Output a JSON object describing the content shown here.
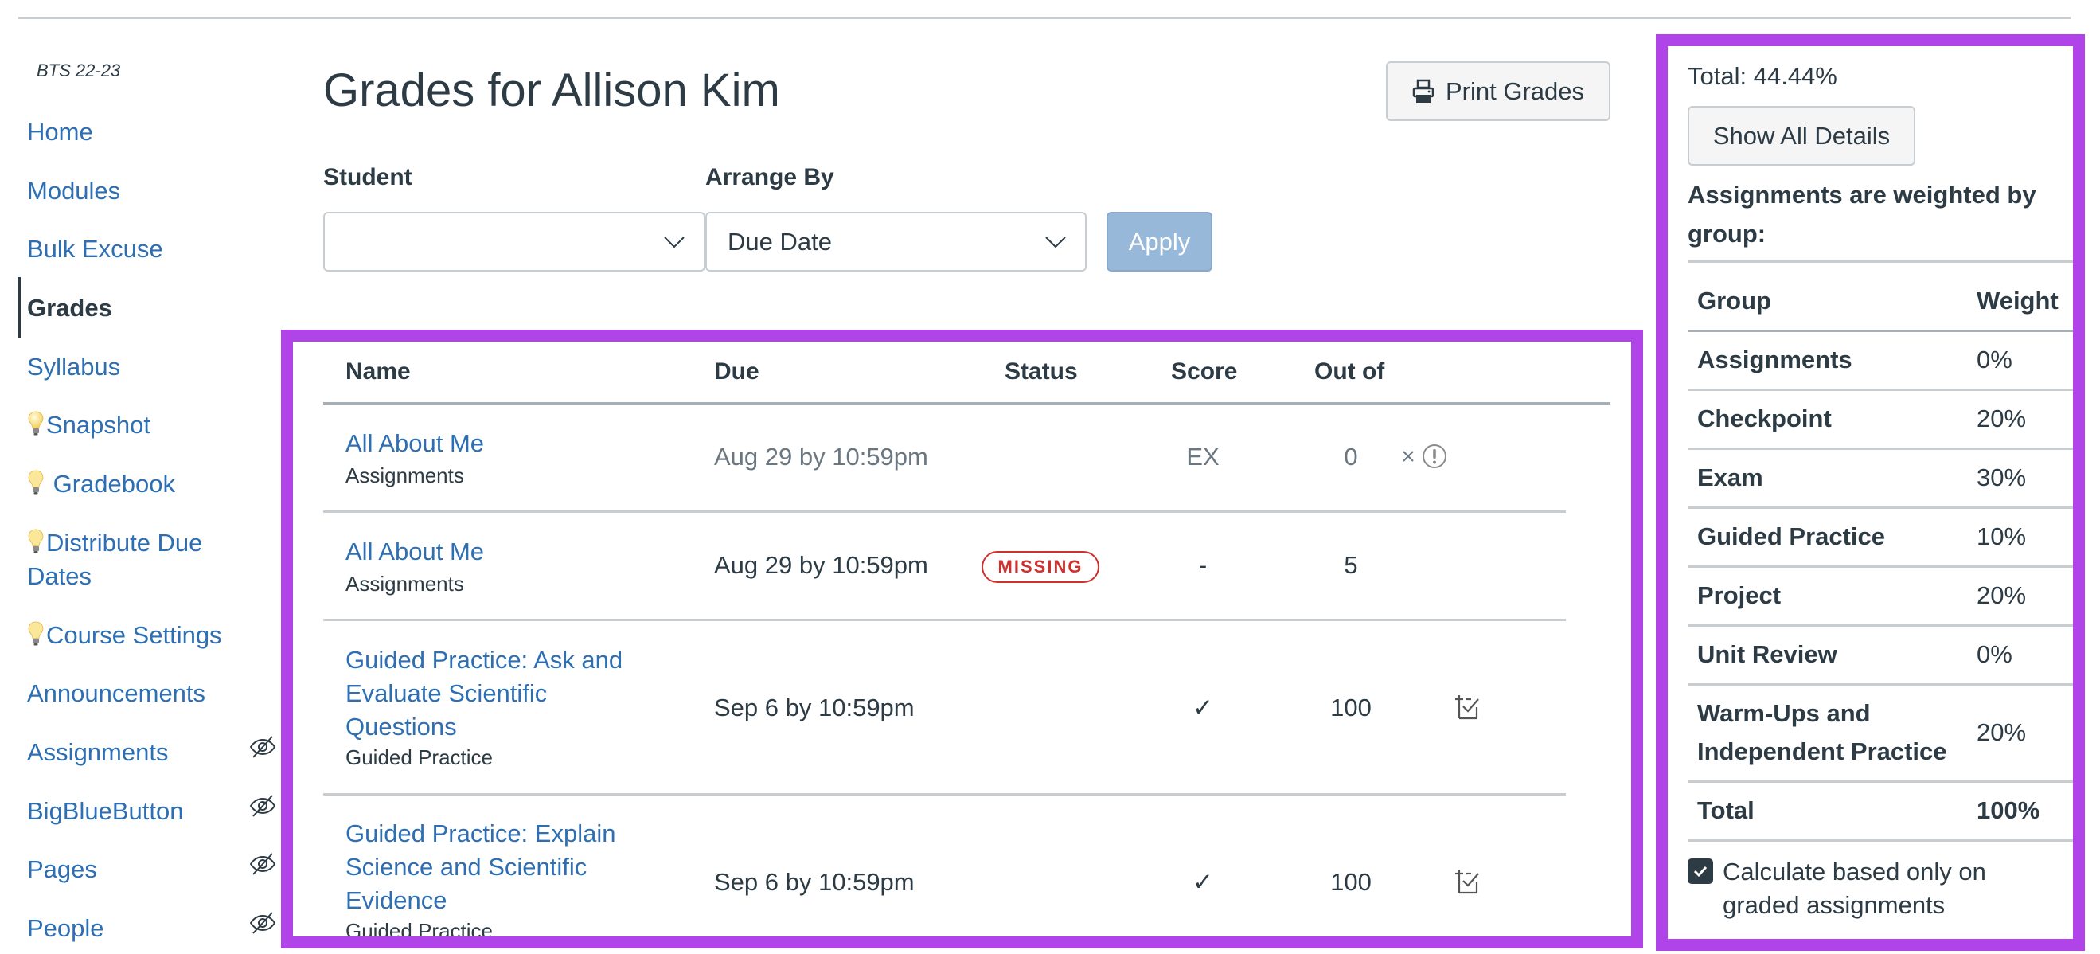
{
  "course": {
    "label": "BTS 22-23"
  },
  "sidebar": {
    "items": [
      {
        "label": "Home",
        "icon": null,
        "hidden": false,
        "active": false
      },
      {
        "label": "Modules",
        "icon": null,
        "hidden": false,
        "active": false
      },
      {
        "label": "Bulk Excuse",
        "icon": null,
        "hidden": false,
        "active": false
      },
      {
        "label": "Grades",
        "icon": null,
        "hidden": false,
        "active": true
      },
      {
        "label": "Syllabus",
        "icon": null,
        "hidden": false,
        "active": false
      },
      {
        "label": "Snapshot",
        "icon": "lightbulb-icon",
        "hidden": false,
        "active": false
      },
      {
        "label": " Gradebook",
        "icon": "lightbulb-icon",
        "hidden": false,
        "active": false
      },
      {
        "label": "Distribute Due",
        "label_line2": "Dates",
        "icon": "lightbulb-icon",
        "hidden": false,
        "active": false
      },
      {
        "label": "Course Settings",
        "icon": "lightbulb-icon",
        "hidden": false,
        "active": false
      },
      {
        "label": "Announcements",
        "icon": null,
        "hidden": false,
        "active": false
      },
      {
        "label": "Assignments",
        "icon": null,
        "hidden": true,
        "active": false
      },
      {
        "label": "BigBlueButton",
        "icon": null,
        "hidden": true,
        "active": false
      },
      {
        "label": "Pages",
        "icon": null,
        "hidden": true,
        "active": false
      },
      {
        "label": "People",
        "icon": null,
        "hidden": true,
        "active": false
      }
    ]
  },
  "header": {
    "title": "Grades for Allison Kim",
    "print_button": "Print Grades"
  },
  "filters": {
    "student_label": "Student",
    "student_value": "",
    "arrange_label": "Arrange By",
    "arrange_value": "Due Date",
    "apply_button": "Apply"
  },
  "assignments_table": {
    "columns": [
      "Name",
      "Due",
      "Status",
      "Score",
      "Out of"
    ],
    "rows": [
      {
        "name": "All About Me",
        "group": "Assignments",
        "due": "Aug 29 by 10:59pm",
        "status": "",
        "score": "EX",
        "out_of": "0",
        "muted": true,
        "icons": [
          "close-icon",
          "warning-circle-icon"
        ]
      },
      {
        "name": "All About Me",
        "group": "Assignments",
        "due": "Aug 29 by 10:59pm",
        "status": "MISSING",
        "score": "-",
        "out_of": "5",
        "muted": false,
        "icons": []
      },
      {
        "name": "Guided Practice: Ask and Evaluate Scientific Questions",
        "group": "Guided Practice",
        "due": "Sep 6 by 10:59pm",
        "status": "",
        "score": "✓",
        "out_of": "100",
        "muted": false,
        "icons": [
          "rubric-check-icon"
        ]
      },
      {
        "name": "Guided Practice: Explain Science and Scientific Evidence",
        "group": "Guided Practice",
        "due": "Sep 6 by 10:59pm",
        "status": "",
        "score": "✓",
        "out_of": "100",
        "muted": false,
        "icons": [
          "rubric-check-icon"
        ]
      }
    ]
  },
  "summary": {
    "total": "Total: 44.44%",
    "show_details_button": "Show All Details",
    "weighted_note": "Assignments are weighted by group:",
    "weights_header": {
      "group": "Group",
      "weight": "Weight"
    },
    "weights": [
      {
        "group": "Assignments",
        "weight": "0%"
      },
      {
        "group": "Checkpoint",
        "weight": "20%"
      },
      {
        "group": "Exam",
        "weight": "30%"
      },
      {
        "group": "Guided Practice",
        "weight": "10%"
      },
      {
        "group": "Project",
        "weight": "20%"
      },
      {
        "group": "Unit Review",
        "weight": "0%"
      },
      {
        "group": "Warm-Ups and Independent Practice",
        "weight": "20%"
      }
    ],
    "weights_total": {
      "group": "Total",
      "weight": "100%"
    },
    "calc_checkbox": {
      "label": "Calculate based only on graded assignments",
      "checked": true
    }
  },
  "colors": {
    "link": "#2d6fb2",
    "text": "#2d3b45",
    "missing": "#d0302e",
    "highlight": "#b044e8",
    "apply_disabled": "#98b8d9"
  }
}
